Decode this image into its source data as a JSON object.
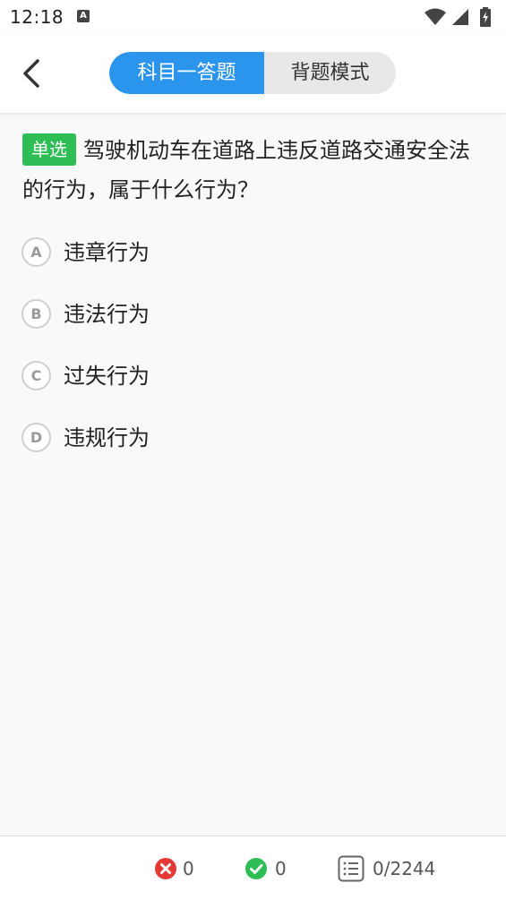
{
  "status_bar": {
    "time": "12:18",
    "notification_icon": "A"
  },
  "header": {
    "tabs": [
      {
        "label": "科目一答题",
        "active": true
      },
      {
        "label": "背题模式",
        "active": false
      }
    ],
    "accent_color": "#2b95ee"
  },
  "question": {
    "type_badge": "单选",
    "badge_color": "#2fbd55",
    "text": "驾驶机动车在道路上违反道路交通安全法的行为，属于什么行为？",
    "options": [
      {
        "letter": "A",
        "text": "违章行为"
      },
      {
        "letter": "B",
        "text": "违法行为"
      },
      {
        "letter": "C",
        "text": "过失行为"
      },
      {
        "letter": "D",
        "text": "违规行为"
      }
    ]
  },
  "bottom_bar": {
    "wrong_count": "0",
    "wrong_color": "#e53935",
    "correct_count": "0",
    "correct_color": "#2fbd55",
    "progress": "0/2244"
  }
}
